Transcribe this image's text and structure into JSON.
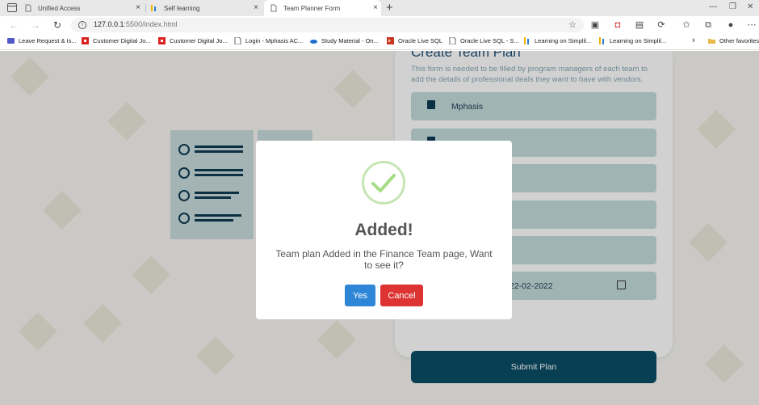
{
  "browser": {
    "tabs": [
      {
        "label": "Unified Access",
        "active": false
      },
      {
        "label": "Self learning",
        "active": false
      },
      {
        "label": "Team Planner Form",
        "active": true
      }
    ],
    "address": {
      "host": "127.0.0.1",
      "path": ":5500/index.html"
    },
    "favorites": [
      {
        "label": "Leave Request & Is...",
        "icon": "teams-icon"
      },
      {
        "label": "Customer Digital Jo...",
        "icon": "app-icon"
      },
      {
        "label": "Customer Digital Jo...",
        "icon": "app-icon"
      },
      {
        "label": "Login - Mphasis AC...",
        "icon": "page-icon"
      },
      {
        "label": "Study Material - On...",
        "icon": "onedrive-icon"
      },
      {
        "label": "Oracle Live SQL",
        "icon": "oracle-icon"
      },
      {
        "label": "Oracle Live SQL - S...",
        "icon": "page-icon"
      },
      {
        "label": "Learning on Simplil...",
        "icon": "simplilearn-icon"
      },
      {
        "label": "Learning on Simplil...",
        "icon": "simplilearn-icon"
      },
      {
        "label": "Other favorites",
        "icon": "folder-icon"
      }
    ]
  },
  "form": {
    "title": "Create Team Plan",
    "description": "This form is needed to be filled by program managers of each team to add the details of professional deals they want to have with vendors.",
    "fields": [
      {
        "value": "Mphasis"
      },
      {
        "value": ""
      },
      {
        "value": ""
      },
      {
        "value": ""
      },
      {
        "value": ""
      },
      {
        "value": "22-02-2022"
      }
    ],
    "submit_label": "Submit Plan"
  },
  "modal": {
    "title": "Added!",
    "text": "Team plan Added in the Finance Team page, Want to see it?",
    "confirm_label": "Yes",
    "cancel_label": "Cancel"
  },
  "colors": {
    "accent": "#0c4e66",
    "confirm": "#2f86d6",
    "cancel": "#dd3333",
    "success": "#a5dc86"
  }
}
